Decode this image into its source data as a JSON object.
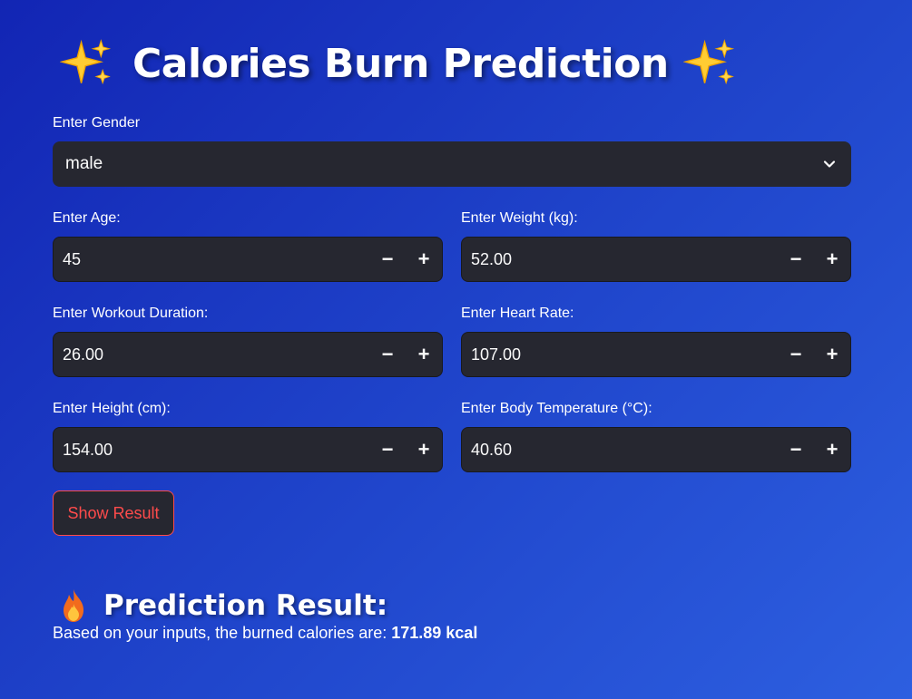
{
  "page": {
    "title": "Calories Burn Prediction",
    "title_icon": "sparkles-icon"
  },
  "form": {
    "gender": {
      "label": "Enter Gender",
      "value": "male"
    },
    "age": {
      "label": "Enter Age:",
      "value": "45"
    },
    "weight": {
      "label": "Enter Weight (kg):",
      "value": "52.00"
    },
    "duration": {
      "label": "Enter Workout Duration:",
      "value": "26.00"
    },
    "heart_rate": {
      "label": "Enter Heart Rate:",
      "value": "107.00"
    },
    "height": {
      "label": "Enter Height (cm):",
      "value": "154.00"
    },
    "body_temp": {
      "label": "Enter Body Temperature (°C):",
      "value": "40.60"
    },
    "decrement_symbol": "−",
    "increment_symbol": "+",
    "submit_label": "Show Result"
  },
  "result": {
    "heading": "Prediction Result:",
    "heading_icon": "fire-icon",
    "text_prefix": "Based on your inputs, the burned calories are: ",
    "value": "171.89 kcal"
  },
  "colors": {
    "background_start": "#1225b4",
    "background_end": "#2d5fe0",
    "input_bg": "#262730",
    "accent_red": "#ff4b4b"
  }
}
